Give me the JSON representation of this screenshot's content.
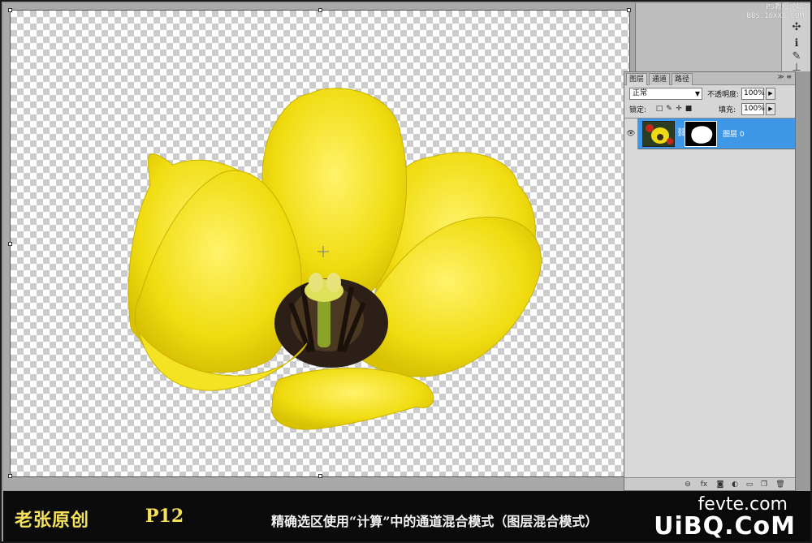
{
  "watermark_top": {
    "line1": "PS教程论坛",
    "line2": "BBS.16XX8.COM"
  },
  "layers_panel": {
    "tabs": [
      "图层",
      "通道",
      "路径"
    ],
    "menu_icon": "≫ ≡",
    "blend_mode": "正常",
    "opacity_label": "不透明度:",
    "opacity_value": "100%",
    "lock_label": "锁定:",
    "fill_label": "填充:",
    "fill_value": "100%",
    "layers": [
      {
        "name": "图层 0",
        "visible": true,
        "has_mask": true,
        "selected": true
      }
    ],
    "footer_icons": [
      "link-icon",
      "fx-icon",
      "mask-icon",
      "adjustment-icon",
      "group-icon",
      "new-layer-icon",
      "trash-icon"
    ]
  },
  "tool_icons": [
    "magic-wand-icon",
    "info-icon",
    "brush-tool-icon",
    "stamp-icon"
  ],
  "caption_band": {
    "author": "老张原创",
    "page": "P12",
    "caption": "精确选区使用“计算”中的通道混合模式（图层混合模式）",
    "watermark_line1": "fevte.com",
    "watermark_line2": "UiBQ.CoM"
  },
  "colors": {
    "flower": "#f2e21a",
    "selection_blue": "#3f97e8",
    "caption_yellow": "#f6e15a"
  }
}
